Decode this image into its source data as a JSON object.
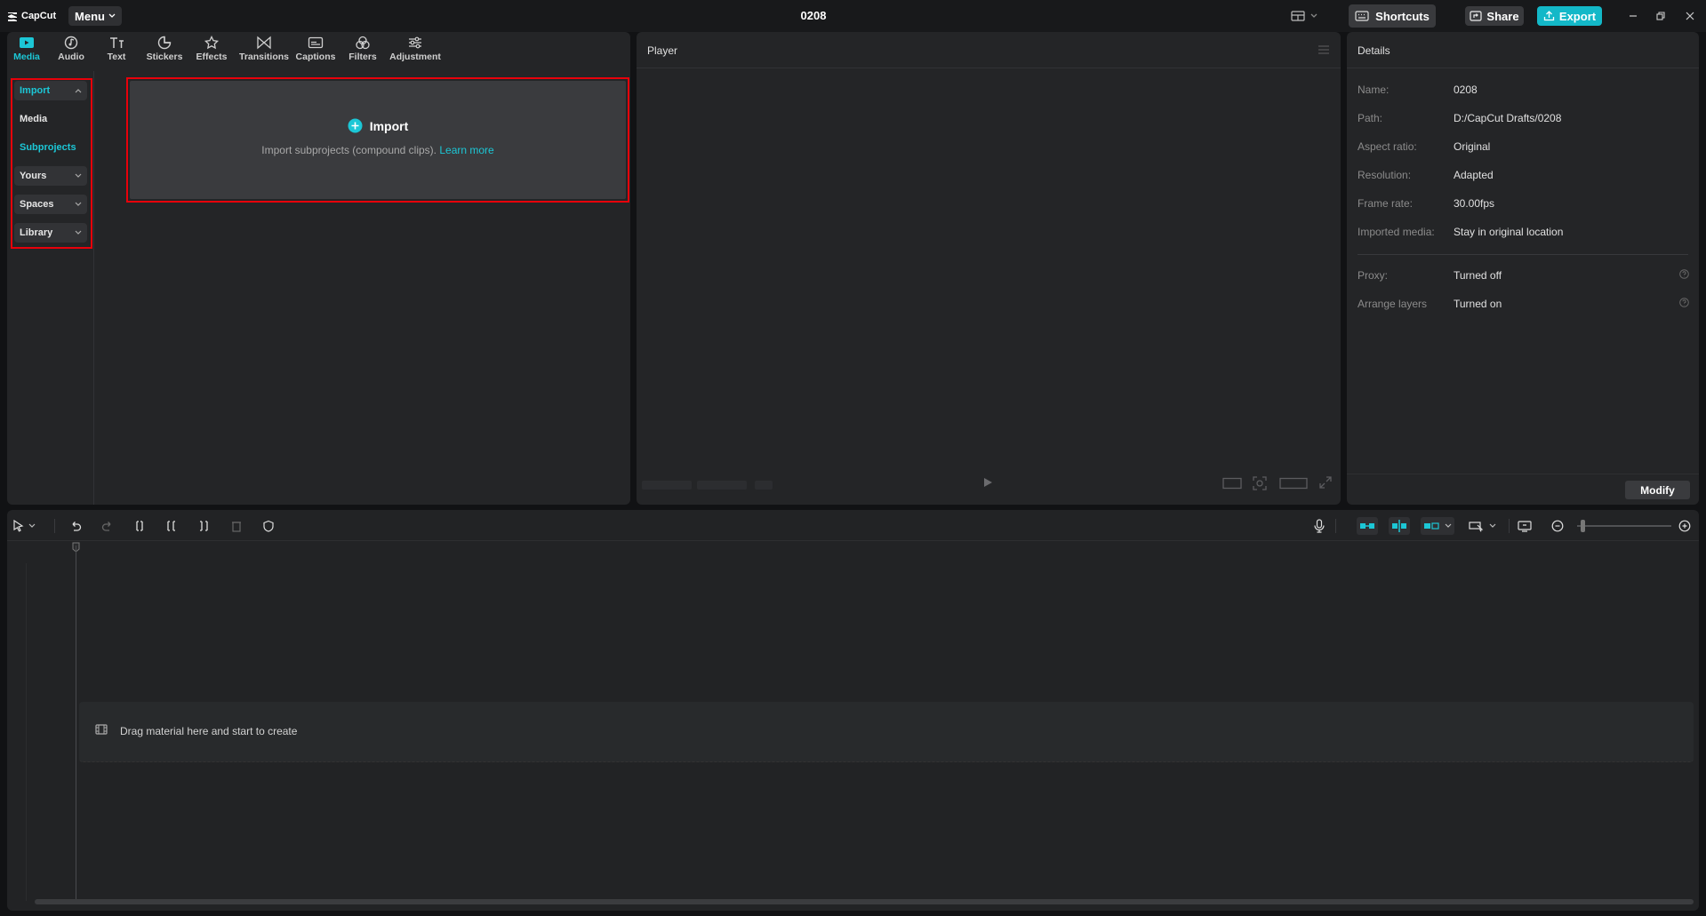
{
  "app": {
    "logo_text": "CapCut",
    "project_name": "0208",
    "menu_label": "Menu"
  },
  "titlebar": {
    "shortcuts_label": "Shortcuts",
    "share_label": "Share",
    "export_label": "Export"
  },
  "tabs": [
    {
      "label": "Media",
      "icon": "media-icon",
      "active": true
    },
    {
      "label": "Audio",
      "icon": "audio-icon"
    },
    {
      "label": "Text",
      "icon": "text-icon"
    },
    {
      "label": "Stickers",
      "icon": "stickers-icon"
    },
    {
      "label": "Effects",
      "icon": "effects-icon"
    },
    {
      "label": "Transitions",
      "icon": "transitions-icon"
    },
    {
      "label": "Captions",
      "icon": "captions-icon"
    },
    {
      "label": "Filters",
      "icon": "filters-icon"
    },
    {
      "label": "Adjustment",
      "icon": "adjustment-icon"
    }
  ],
  "sidebar": {
    "items": [
      {
        "label": "Import",
        "expanded": true
      },
      {
        "label": "Media"
      },
      {
        "label": "Subprojects",
        "selected": true
      },
      {
        "label": "Yours"
      },
      {
        "label": "Spaces"
      },
      {
        "label": "Library"
      }
    ]
  },
  "import_card": {
    "title": "Import",
    "description": "Import subprojects (compound clips).",
    "learn_more": "Learn more"
  },
  "player": {
    "title": "Player"
  },
  "details": {
    "title": "Details",
    "rows": [
      {
        "label": "Name:",
        "value": "0208"
      },
      {
        "label": "Path:",
        "value": "D:/CapCut Drafts/0208"
      },
      {
        "label": "Aspect ratio:",
        "value": "Original"
      },
      {
        "label": "Resolution:",
        "value": "Adapted"
      },
      {
        "label": "Frame rate:",
        "value": "30.00fps"
      },
      {
        "label": "Imported media:",
        "value": "Stay in original location"
      },
      {
        "label": "Proxy:",
        "value": "Turned off"
      },
      {
        "label": "Arrange layers",
        "value": "Turned on"
      }
    ],
    "modify_label": "Modify"
  },
  "timeline": {
    "drop_hint": "Drag material here and start to create"
  },
  "colors": {
    "accent": "#1cc7d6",
    "highlight_border": "#e8000a",
    "panel": "#242527",
    "background": "#111214"
  }
}
